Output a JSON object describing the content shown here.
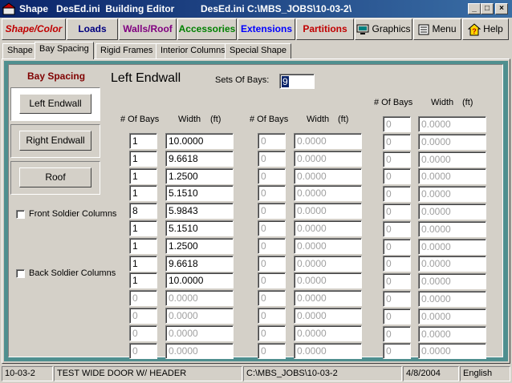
{
  "window": {
    "title_app": "Shape",
    "title_ini": "DesEd.ini  Building Editor",
    "title_path": "DesEd.ini C:\\MBS_JOBS\\10-03-2\\",
    "controls": [
      "_",
      "□",
      "×"
    ]
  },
  "toolbar": [
    {
      "label": "Shape/Color",
      "color": "#c00000"
    },
    {
      "label": "Loads",
      "color": "#000080"
    },
    {
      "label": "Walls/Roof",
      "color": "#800080"
    },
    {
      "label": "Accessories",
      "color": "#008000"
    },
    {
      "label": "Extensions",
      "color": "#0000ff"
    },
    {
      "label": "Partitions",
      "color": "#c00000"
    },
    {
      "label": "Graphics",
      "color": "#000000",
      "icon": "monitor-icon"
    },
    {
      "label": "Menu",
      "color": "#000000",
      "icon": "menu-icon"
    },
    {
      "label": "Help",
      "color": "#000000",
      "icon": "help-icon"
    }
  ],
  "tabs": [
    "Shape",
    "Bay Spacing",
    "Rigid Frames",
    "Interior Columns",
    "Special Shape"
  ],
  "active_tab": "Bay Spacing",
  "sidebar": {
    "heading": "Bay Spacing",
    "buttons": [
      "Left Endwall",
      "Right Endwall",
      "Roof"
    ],
    "front_soldier_label": "Front Soldier Columns",
    "back_soldier_label": "Back Soldier Columns",
    "front_soldier_checked": false,
    "back_soldier_checked": false
  },
  "main": {
    "title": "Left Endwall",
    "sets_label": "Sets Of Bays:",
    "sets_value": "9",
    "col_bays_header": "# Of Bays",
    "col_width_header": "Width",
    "col_unit": "(ft)"
  },
  "grid": {
    "col1": [
      {
        "bays": "1",
        "width": "10.0000",
        "enabled": true
      },
      {
        "bays": "1",
        "width": "9.6618",
        "enabled": true
      },
      {
        "bays": "1",
        "width": "1.2500",
        "enabled": true
      },
      {
        "bays": "1",
        "width": "5.1510",
        "enabled": true
      },
      {
        "bays": "8",
        "width": "5.9843",
        "enabled": true
      },
      {
        "bays": "1",
        "width": "5.1510",
        "enabled": true
      },
      {
        "bays": "1",
        "width": "1.2500",
        "enabled": true
      },
      {
        "bays": "1",
        "width": "9.6618",
        "enabled": true
      },
      {
        "bays": "1",
        "width": "10.0000",
        "enabled": true
      },
      {
        "bays": "0",
        "width": "0.0000",
        "enabled": false
      },
      {
        "bays": "0",
        "width": "0.0000",
        "enabled": false
      },
      {
        "bays": "0",
        "width": "0.0000",
        "enabled": false
      },
      {
        "bays": "0",
        "width": "0.0000",
        "enabled": false
      }
    ],
    "col2": [
      {
        "bays": "0",
        "width": "0.0000"
      },
      {
        "bays": "0",
        "width": "0.0000"
      },
      {
        "bays": "0",
        "width": "0.0000"
      },
      {
        "bays": "0",
        "width": "0.0000"
      },
      {
        "bays": "0",
        "width": "0.0000"
      },
      {
        "bays": "0",
        "width": "0.0000"
      },
      {
        "bays": "0",
        "width": "0.0000"
      },
      {
        "bays": "0",
        "width": "0.0000"
      },
      {
        "bays": "0",
        "width": "0.0000"
      },
      {
        "bays": "0",
        "width": "0.0000"
      },
      {
        "bays": "0",
        "width": "0.0000"
      },
      {
        "bays": "0",
        "width": "0.0000"
      },
      {
        "bays": "0",
        "width": "0.0000"
      }
    ],
    "col3": [
      {
        "bays": "0",
        "width": "0.0000"
      },
      {
        "bays": "0",
        "width": "0.0000"
      },
      {
        "bays": "0",
        "width": "0.0000"
      },
      {
        "bays": "0",
        "width": "0.0000"
      },
      {
        "bays": "0",
        "width": "0.0000"
      },
      {
        "bays": "0",
        "width": "0.0000"
      },
      {
        "bays": "0",
        "width": "0.0000"
      },
      {
        "bays": "0",
        "width": "0.0000"
      },
      {
        "bays": "0",
        "width": "0.0000"
      },
      {
        "bays": "0",
        "width": "0.0000"
      },
      {
        "bays": "0",
        "width": "0.0000"
      },
      {
        "bays": "0",
        "width": "0.0000"
      },
      {
        "bays": "0",
        "width": "0.0000"
      },
      {
        "bays": "0",
        "width": "0.0000"
      }
    ]
  },
  "statusbar": {
    "job": "10-03-2",
    "description": "TEST WIDE DOOR W/ HEADER",
    "path": "C:\\MBS_JOBS\\10-03-2",
    "date": "4/8/2004",
    "language": "English"
  }
}
